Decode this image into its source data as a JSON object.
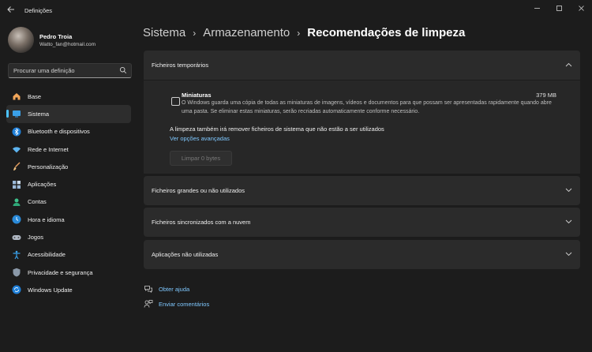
{
  "window": {
    "title": "Definições"
  },
  "profile": {
    "name": "Pedro Troia",
    "email": "Watto_fan@hotmail.com"
  },
  "search": {
    "placeholder": "Procurar uma definição"
  },
  "sidebar": {
    "items": [
      {
        "label": "Base",
        "icon": "home-icon"
      },
      {
        "label": "Sistema",
        "icon": "system-icon",
        "active": true
      },
      {
        "label": "Bluetooth e dispositivos",
        "icon": "bluetooth-icon"
      },
      {
        "label": "Rede e Internet",
        "icon": "wifi-icon"
      },
      {
        "label": "Personalização",
        "icon": "brush-icon"
      },
      {
        "label": "Aplicações",
        "icon": "apps-icon"
      },
      {
        "label": "Contas",
        "icon": "account-icon"
      },
      {
        "label": "Hora e idioma",
        "icon": "time-language-icon"
      },
      {
        "label": "Jogos",
        "icon": "gamepad-icon"
      },
      {
        "label": "Acessibilidade",
        "icon": "accessibility-icon"
      },
      {
        "label": "Privacidade e segurança",
        "icon": "shield-icon"
      },
      {
        "label": "Windows Update",
        "icon": "update-icon"
      }
    ]
  },
  "breadcrumb": {
    "level1": "Sistema",
    "level2": "Armazenamento",
    "current": "Recomendações de limpeza"
  },
  "sections": {
    "temp": {
      "title": "Ficheiros temporários",
      "item_title": "Miniaturas",
      "item_size": "379 MB",
      "item_desc": "O Windows guarda uma cópia de todas as miniaturas de imagens, vídeos e documentos para que possam ser apresentadas rapidamente quando abre uma pasta. Se eliminar estas miniaturas, serão recriadas automaticamente conforme necessário.",
      "note": "A limpeza também irá remover ficheiros de sistema que não estão a ser utilizados",
      "advanced_link": "Ver opções avançadas",
      "clean_button": "Limpar 0 bytes"
    },
    "large": {
      "title": "Ficheiros grandes ou não utilizados"
    },
    "synced": {
      "title": "Ficheiros sincronizados com a nuvem"
    },
    "unused_apps": {
      "title": "Aplicações não utilizadas"
    }
  },
  "footer": {
    "help": "Obter ajuda",
    "feedback": "Enviar comentários"
  },
  "colors": {
    "accent": "#4cc2ff",
    "link": "#7fc8ff",
    "background": "#1c1c1c",
    "card": "#2b2b2b"
  }
}
